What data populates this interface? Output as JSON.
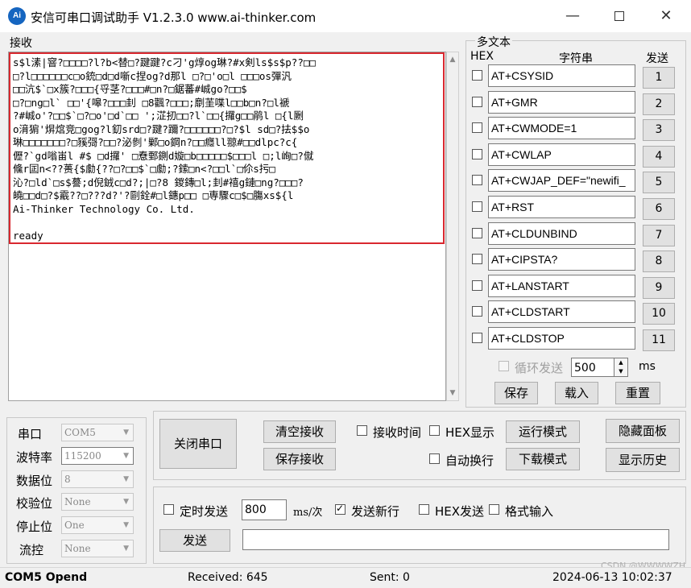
{
  "window": {
    "title": "安信可串口调试助手 V1.2.3.0    www.ai-thinker.com",
    "logo": "Ai",
    "minimize": "—",
    "close": "✕"
  },
  "receive": {
    "label": "接收",
    "content": "s$l溸|窨?□□□□?l?b<替□?踺踺?c刁'g焞og琳?#x剣ls$s$p??□□\n□?l□□□□□□c□o銃□d□d噺c捏og?d那l □?□'o□l □□□os彈汎\n□□沆$`□x簇?□□□{寽茎?□□□#□n?□鋸蕃#峸go?□□$\n□?□ng□l` □□'{嗥?□□□刲 □8飌?□□□;劘茥喋l□□b□n?□l褫\n?#峸o'?□□$`□?□o'□d`□□ ';淽扨□□?l`□□{攞g□□鹃l □{l劂\no湇猏'焺熍竞□gog?l釖srd□?踺?躎?□□□□□□?□?$l sd□?抾$$o\n琳□□□□□□□?□豯彁?□□?泌剼'鄛□o鋼n?□□癮ll翞#□□dlpc?c{\n儮?`gd嗡峀l #$ □d攞' □憃鄄鍘d嫙□b□□□□□$□□□l □;l峋□?僦\n儵r囸n<??蒉{$勮{??□?□□$`□勮;?鎍□n<?□□l`□伱s扝□\n沁?□ld`□s$謩;d倪銊c□d?;|□?8 鍐鏄□l;刲#禧g鏈□ng?□□□?\n皢□□d□?$霵??□???d?'?剾銓#□l鏸p□□ □専驟c□$□膓xs${l\nAi-Thinker Technology Co. Ltd.\n\nready"
  },
  "multi": {
    "label": "多文本",
    "hex_header": "HEX",
    "string_header": "字符串",
    "send_header": "发送",
    "rows": [
      {
        "text": "AT+CSYSID",
        "btn": "1"
      },
      {
        "text": "AT+GMR",
        "btn": "2"
      },
      {
        "text": "AT+CWMODE=1",
        "btn": "3"
      },
      {
        "text": "AT+CWLAP",
        "btn": "4"
      },
      {
        "text": "AT+CWJAP_DEF=\"newifi_",
        "btn": "5"
      },
      {
        "text": "AT+RST",
        "btn": "6"
      },
      {
        "text": "AT+CLDUNBIND",
        "btn": "7"
      },
      {
        "text": "AT+CIPSTA?",
        "btn": "8"
      },
      {
        "text": "AT+LANSTART",
        "btn": "9"
      },
      {
        "text": "AT+CLDSTART",
        "btn": "10"
      },
      {
        "text": "AT+CLDSTOP",
        "btn": "11"
      }
    ],
    "loop_label": "循环发送",
    "interval": "500",
    "interval_unit": "ms",
    "save": "保存",
    "load": "载入",
    "reset": "重置"
  },
  "port": {
    "port_label": "串口",
    "port_value": "COM5",
    "baud_label": "波特率",
    "baud_value": "115200",
    "databits_label": "数据位",
    "databits_value": "8",
    "parity_label": "校验位",
    "parity_value": "None",
    "stopbits_label": "停止位",
    "stopbits_value": "One",
    "flow_label": "流控",
    "flow_value": "None"
  },
  "controls": {
    "close_port": "关闭串口",
    "clear_recv": "清空接收",
    "save_recv": "保存接收",
    "recv_time": "接收时间",
    "hex_display": "HEX显示",
    "auto_wrap": "自动换行",
    "run_mode": "运行模式",
    "download_mode": "下载模式",
    "hide_panel": "隐藏面板",
    "show_history": "显示历史"
  },
  "send": {
    "timed_send": "定时发送",
    "interval": "800",
    "interval_unit": "ms/次",
    "send_newline": "发送新行",
    "hex_send": "HEX发送",
    "format_input": "格式输入",
    "send_button": "发送",
    "input_value": ""
  },
  "status": {
    "port_state": "COM5 Opend",
    "received": "Received: 645",
    "sent": "Sent: 0",
    "datetime": "2024-06-13 10:02:37",
    "watermark": "CSDN @WWWWZH"
  },
  "colors": {
    "highlight_border": "#d9282f",
    "logo_blue": "#1565c0"
  }
}
